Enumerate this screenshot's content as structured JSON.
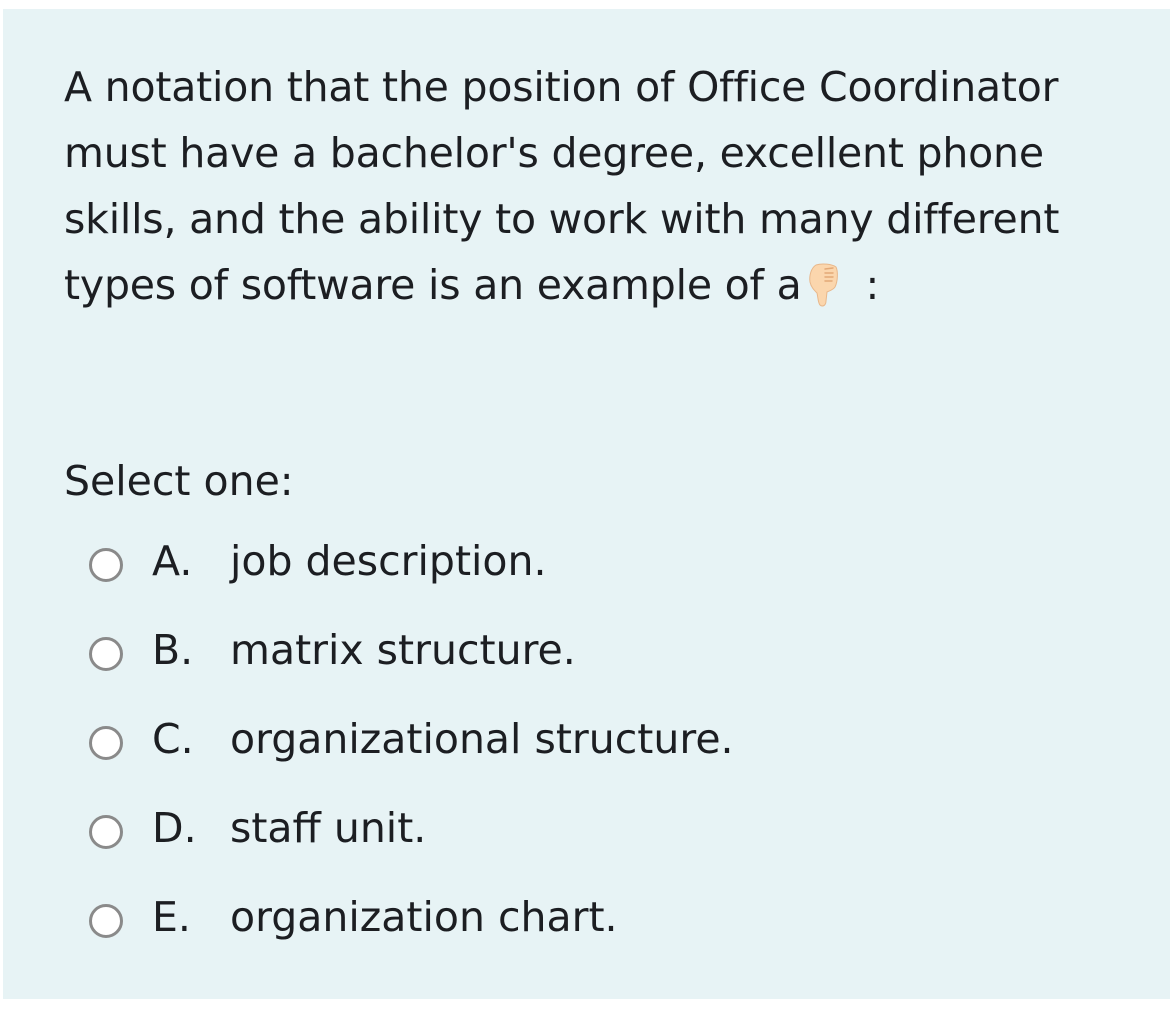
{
  "question": {
    "text": "A notation that the position of Office Coordinator must have a bachelor's degree, excellent phone skills, and the ability to work with many different types of software is an example of a",
    "emoji_icon": "thumbs-down-emoji",
    "suffix": ":"
  },
  "prompt": "Select one:",
  "options": [
    {
      "letter": "A.",
      "text": "job description."
    },
    {
      "letter": "B.",
      "text": "matrix structure."
    },
    {
      "letter": "C.",
      "text": "organizational structure."
    },
    {
      "letter": "D.",
      "text": "staff unit."
    },
    {
      "letter": "E.",
      "text": "organization chart."
    }
  ],
  "colors": {
    "panel_background": "#e7f3f5",
    "text": "#1c1e22",
    "radio_border": "#8a8a8a"
  }
}
